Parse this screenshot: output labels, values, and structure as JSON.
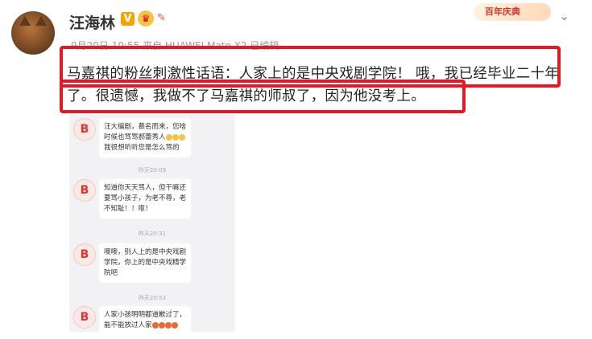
{
  "post": {
    "username": "汪海林",
    "vip_badge": "V",
    "crown_glyph": "♛",
    "tag_glyph": "✎",
    "meta": "9月20日 10:55 来自 HUAWEI Mate X2 已编辑",
    "banner": "百年庆典",
    "caption_line1": "马嘉祺的粉丝刺激性话语：人家上的是中央戏剧学院！ 哦，我已经毕业二十年",
    "caption_line2": "了。很遗憾，我做不了马嘉祺的师叔了，因为他没考上。",
    "menu_glyph": "⌄"
  },
  "chat": {
    "avatar_letter": "B",
    "messages": [
      {
        "lines": [
          "汪大编剧，慕名而来，您啥",
          "时候也骂骂郝蕾秀人"
        ],
        "last_line": "我很想听听您是怎么骂的",
        "emoji": [
          "y",
          "y",
          "y"
        ]
      },
      {
        "lines": [
          "知道你天天骂人，但干嘛还",
          "要骂小孩子，为老不尊，老",
          "不知耻！！呕！"
        ]
      },
      {
        "lines": [
          "噢噢，别人上的是中央戏剧",
          "学院，你上的是中央戏精学",
          "院吧"
        ]
      },
      {
        "lines": [
          "人家小孩明明都道歉过了，",
          "能不能放过人家"
        ],
        "emoji": [
          "r",
          "r",
          "r",
          "r"
        ]
      }
    ],
    "timestamps": [
      "昨天20:09",
      "昨天20:31",
      "昨天20:53"
    ]
  },
  "colors": {
    "highlight": "#e11b24",
    "chat_bg": "#f2f2f4"
  }
}
